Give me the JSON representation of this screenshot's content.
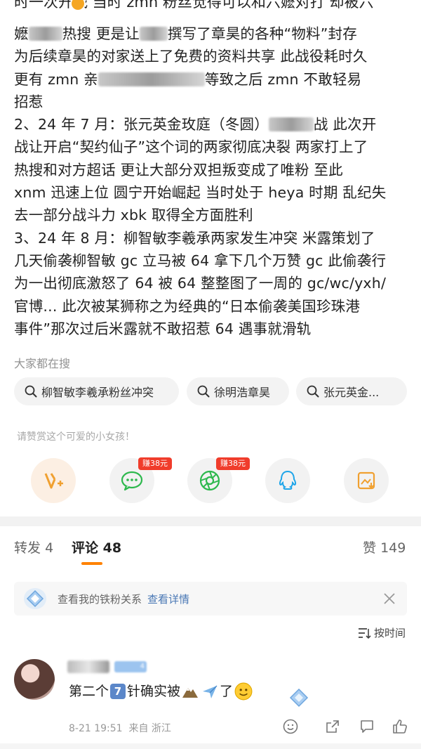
{
  "post": {
    "cut_line": "时一次开战 当时 zmn 粉丝觉得可以和六嬷对打 却被六",
    "line1a": "嬷",
    "line1b": "热搜 更是让",
    "line1c": "撰写了章昊的各种“物料”封存",
    "line2": "为后续章昊的对家送上了免费的资料共享 此战役耗时久",
    "line3a": "更有 zmn 亲",
    "line3b": "等致之后 zmn 不敢轻易",
    "line4": "招惹",
    "line5a": "2、24 年 7 月：张元英金玫庭（冬圆）",
    "line5b": "战 此次开",
    "line6": "战让开启“契约仙子”这个词的两家彻底决裂 两家打上了",
    "line7": "热搜和对方超话 更让大部分双担叛变成了唯粉 至此",
    "line8": "xnm 迅速上位 圆宁开始崛起 当时处于 heya 时期 乱纪失",
    "line9": "去一部分战斗力 xbk 取得全方面胜利",
    "line10": "3、24 年 8 月：柳智敏李羲承两家发生冲突 米露策划了",
    "line11": "几天偷袭柳智敏 gc 立马被 64 拿下几个万赞 gc 此偷袭行",
    "line12": "为一出彻底激怒了 64 被 64 整整图了一周的 gc/wc/yxh/",
    "line13": "官博... 此次被某狮称之为经典的“日本偷袭美国珍珠港",
    "line14": "事件”那次过后米露就不敢招惹 64 遇事就滑轨"
  },
  "trending": {
    "label": "大家都在搜",
    "items": [
      "柳智敏李羲承粉丝冲突",
      "徐明浩章昊",
      "张元英金..."
    ]
  },
  "tip": {
    "label": "请赞赏这个可爱的小女孩！",
    "earn_badge_1": "赚38元",
    "earn_badge_2": "赚38元"
  },
  "tabs": {
    "repost_label": "转发",
    "repost_count": "4",
    "comment_label": "评论",
    "comment_count": "48",
    "like_label": "赞",
    "like_count": "149"
  },
  "fan_notice": {
    "text": "查看我的铁粉关系",
    "link": "查看详情"
  },
  "sort_label": "按时间",
  "comment": {
    "badge_level": "4",
    "text_a": "第二个",
    "text_b": "针确实被",
    "text_c": "了",
    "num_badge": "7",
    "date": "8-21 19:51",
    "source": "来自 浙江"
  },
  "colors": {
    "accent": "#ff8200",
    "link": "#4a78b5",
    "earn_red": "#f03c2b"
  },
  "icons": [
    "search-icon",
    "v-plus-icon",
    "wechat-icon",
    "moments-icon",
    "qq-icon",
    "save-image-icon",
    "diamond-icon",
    "close-icon",
    "sort-icon",
    "emoji-icon",
    "share-icon",
    "comment-icon",
    "like-icon"
  ]
}
